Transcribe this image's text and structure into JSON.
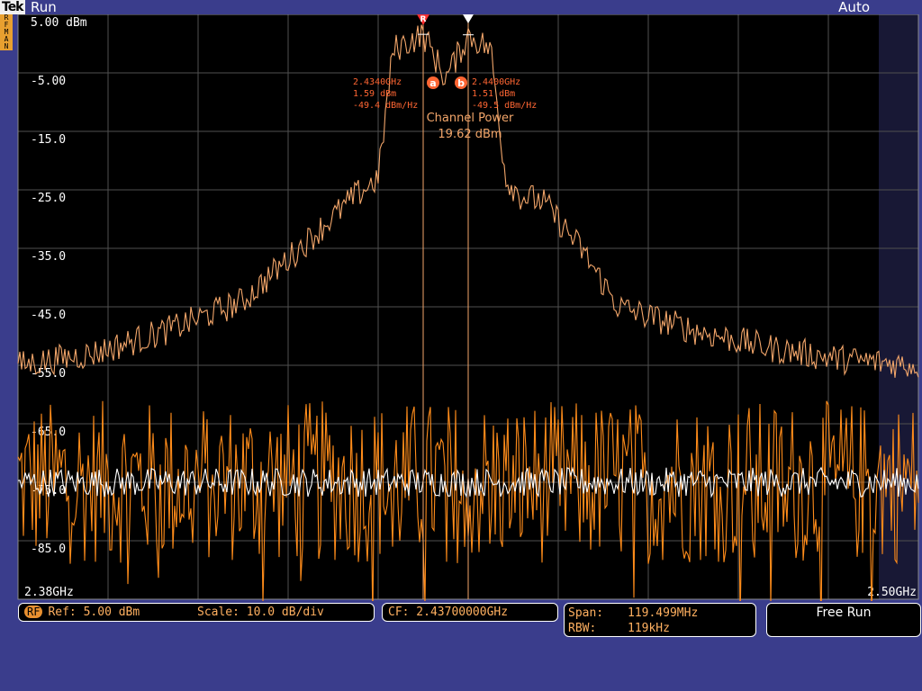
{
  "header": {
    "brand": "Tek",
    "run_state": "Run",
    "mode": "Auto",
    "side_badge": "RFMAN"
  },
  "colors": {
    "background": "#3a3d8c",
    "graticule_bg": "#000000",
    "grid": "#505050",
    "trace_primary": "#f3a66a",
    "trace_orange": "#ff8c1a",
    "trace_white": "#ffffff",
    "marker": "#ff6633",
    "channel_power": "#f3a66a"
  },
  "axes": {
    "y_labels": [
      "5.00 dBm",
      "-5.00",
      "-15.0",
      "-25.0",
      "-35.0",
      "-45.0",
      "-55.0",
      "-65.0",
      "-75.0",
      "-85.0"
    ],
    "x_start": "2.38GHz",
    "x_end": "2.50GHz"
  },
  "markers": [
    {
      "id": "a",
      "flag": "R",
      "freq": "2.4340GHz",
      "power": "1.59 dBm",
      "density": "-49.4 dBm/Hz"
    },
    {
      "id": "b",
      "flag": "",
      "freq": "2.4400GHz",
      "power": "1.51 dBm",
      "density": "-49.5 dBm/Hz"
    }
  ],
  "channel_power": {
    "label": "Channel Power",
    "value": "19.62 dBm"
  },
  "status": {
    "rf_badge": "RF",
    "ref": "Ref: 5.00 dBm",
    "scale": "Scale: 10.0 dB/div",
    "cf": "CF: 2.43700000GHz",
    "span_label": "Span:",
    "span_value": "119.499MHz",
    "rbw_label": "RBW:",
    "rbw_value": "119kHz",
    "trigger": "Free Run"
  },
  "chart_data": {
    "type": "line",
    "x_unit": "GHz",
    "y_unit": "dBm",
    "xlim": [
      2.38,
      2.5
    ],
    "ylim": [
      -95,
      5
    ],
    "grid": true,
    "series": [
      {
        "x": [
          2.38,
          2.39,
          2.4,
          2.41,
          2.415,
          2.42,
          2.425,
          2.428,
          2.43,
          2.434,
          2.437,
          2.44,
          2.443,
          2.445,
          2.447,
          2.45,
          2.455,
          2.46,
          2.47,
          2.48,
          2.49,
          2.5
        ],
        "values": [
          -55,
          -53,
          -49,
          -44,
          -38,
          -32,
          -26,
          -23,
          -1,
          1.59,
          -6,
          1.51,
          -1,
          -23,
          -26,
          -27,
          -35,
          -45,
          -49,
          -52,
          -54,
          -55
        ]
      },
      {
        "x": [
          2.38,
          2.5
        ],
        "values": [
          -75,
          -75
        ]
      },
      {
        "x": [
          2.38,
          2.5
        ],
        "values": [
          -75,
          -75
        ]
      }
    ]
  }
}
